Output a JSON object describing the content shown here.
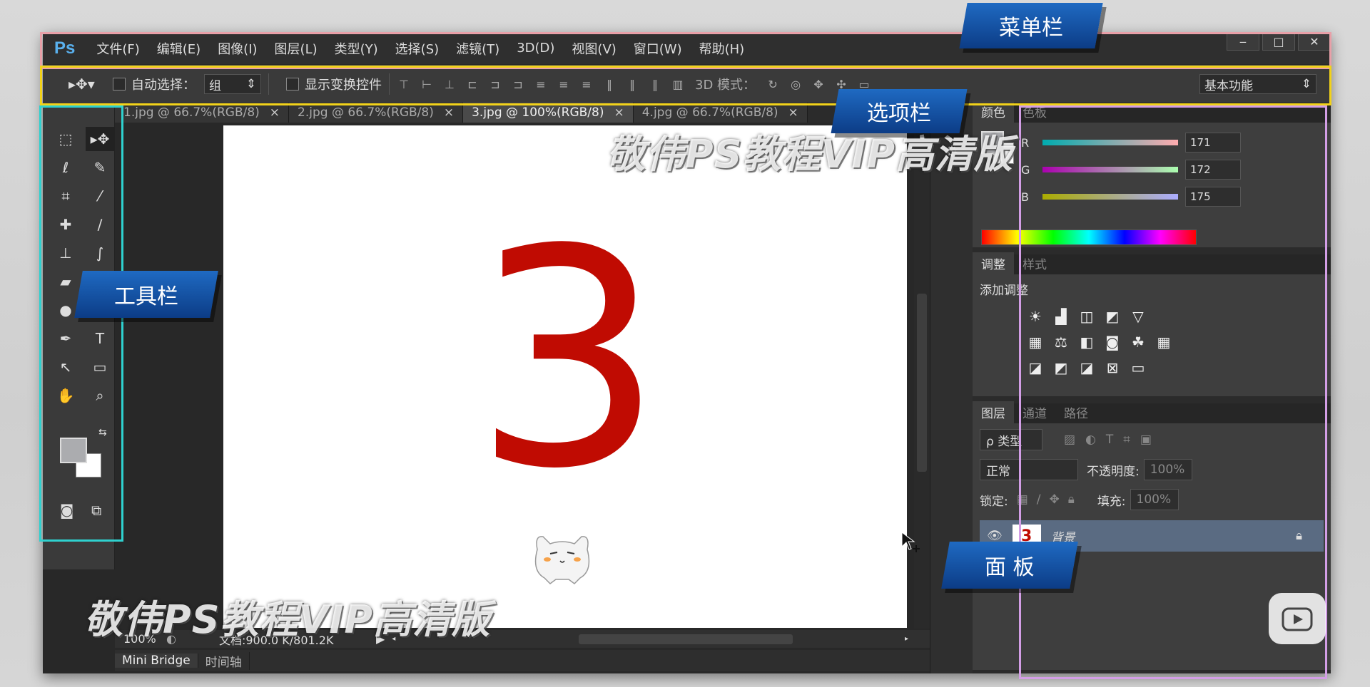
{
  "app": {
    "logo": "Ps",
    "menu": [
      "文件(F)",
      "编辑(E)",
      "图像(I)",
      "图层(L)",
      "类型(Y)",
      "选择(S)",
      "滤镜(T)",
      "3D(D)",
      "视图(V)",
      "窗口(W)",
      "帮助(H)"
    ],
    "window_controls": {
      "minimize": "‒",
      "maximize": "□",
      "close": "✕"
    }
  },
  "options": {
    "auto_select_label": "自动选择：",
    "auto_select_value": "组",
    "show_transform_label": "显示变换控件",
    "mode3d_label": "3D 模式：",
    "workspace_value": "基本功能"
  },
  "tabs": [
    {
      "label": "1.jpg @ 66.7%(RGB/8)",
      "close": "×"
    },
    {
      "label": "2.jpg @ 66.7%(RGB/8)",
      "close": "×"
    },
    {
      "label": "3.jpg @ 100%(RGB/8)",
      "close": "×"
    },
    {
      "label": "4.jpg @ 66.7%(RGB/8)",
      "close": "×"
    }
  ],
  "canvas": {
    "big_text": "3",
    "text_color": "#c00b02"
  },
  "status": {
    "zoom": "100%",
    "doc_info": "文档:900.0 K/801.2K"
  },
  "bottom_tabs": [
    "Mini Bridge",
    "时间轴"
  ],
  "color_panel": {
    "tabs": [
      "颜色",
      "色板"
    ],
    "r_label": "R",
    "r": "171",
    "g_label": "G",
    "g": "172",
    "b_label": "B",
    "b": "175"
  },
  "adjust_panel": {
    "tabs": [
      "调整",
      "样式"
    ],
    "title": "添加调整"
  },
  "layers_panel": {
    "tabs": [
      "图层",
      "通道",
      "路径"
    ],
    "filter_label": "ρ 类型",
    "blend_mode": "正常",
    "opacity_label": "不透明度:",
    "opacity_value": "100%",
    "lock_label": "锁定:",
    "fill_label": "填充:",
    "fill_value": "100%",
    "layer_name": "背景",
    "layer_thumb": "3"
  },
  "annotations": {
    "menubar": "菜单栏",
    "options": "选项栏",
    "tools": "工具栏",
    "panels": "面 板"
  },
  "watermarks": [
    "敬伟PS教程VIP高清版",
    "敬伟PS教程VIP高清版"
  ],
  "colors": {
    "menubar_border": "#e8a0a8",
    "options_border": "#f2d21a",
    "tools_border": "#2fd1cf",
    "panels_border": "#d39ee6"
  }
}
